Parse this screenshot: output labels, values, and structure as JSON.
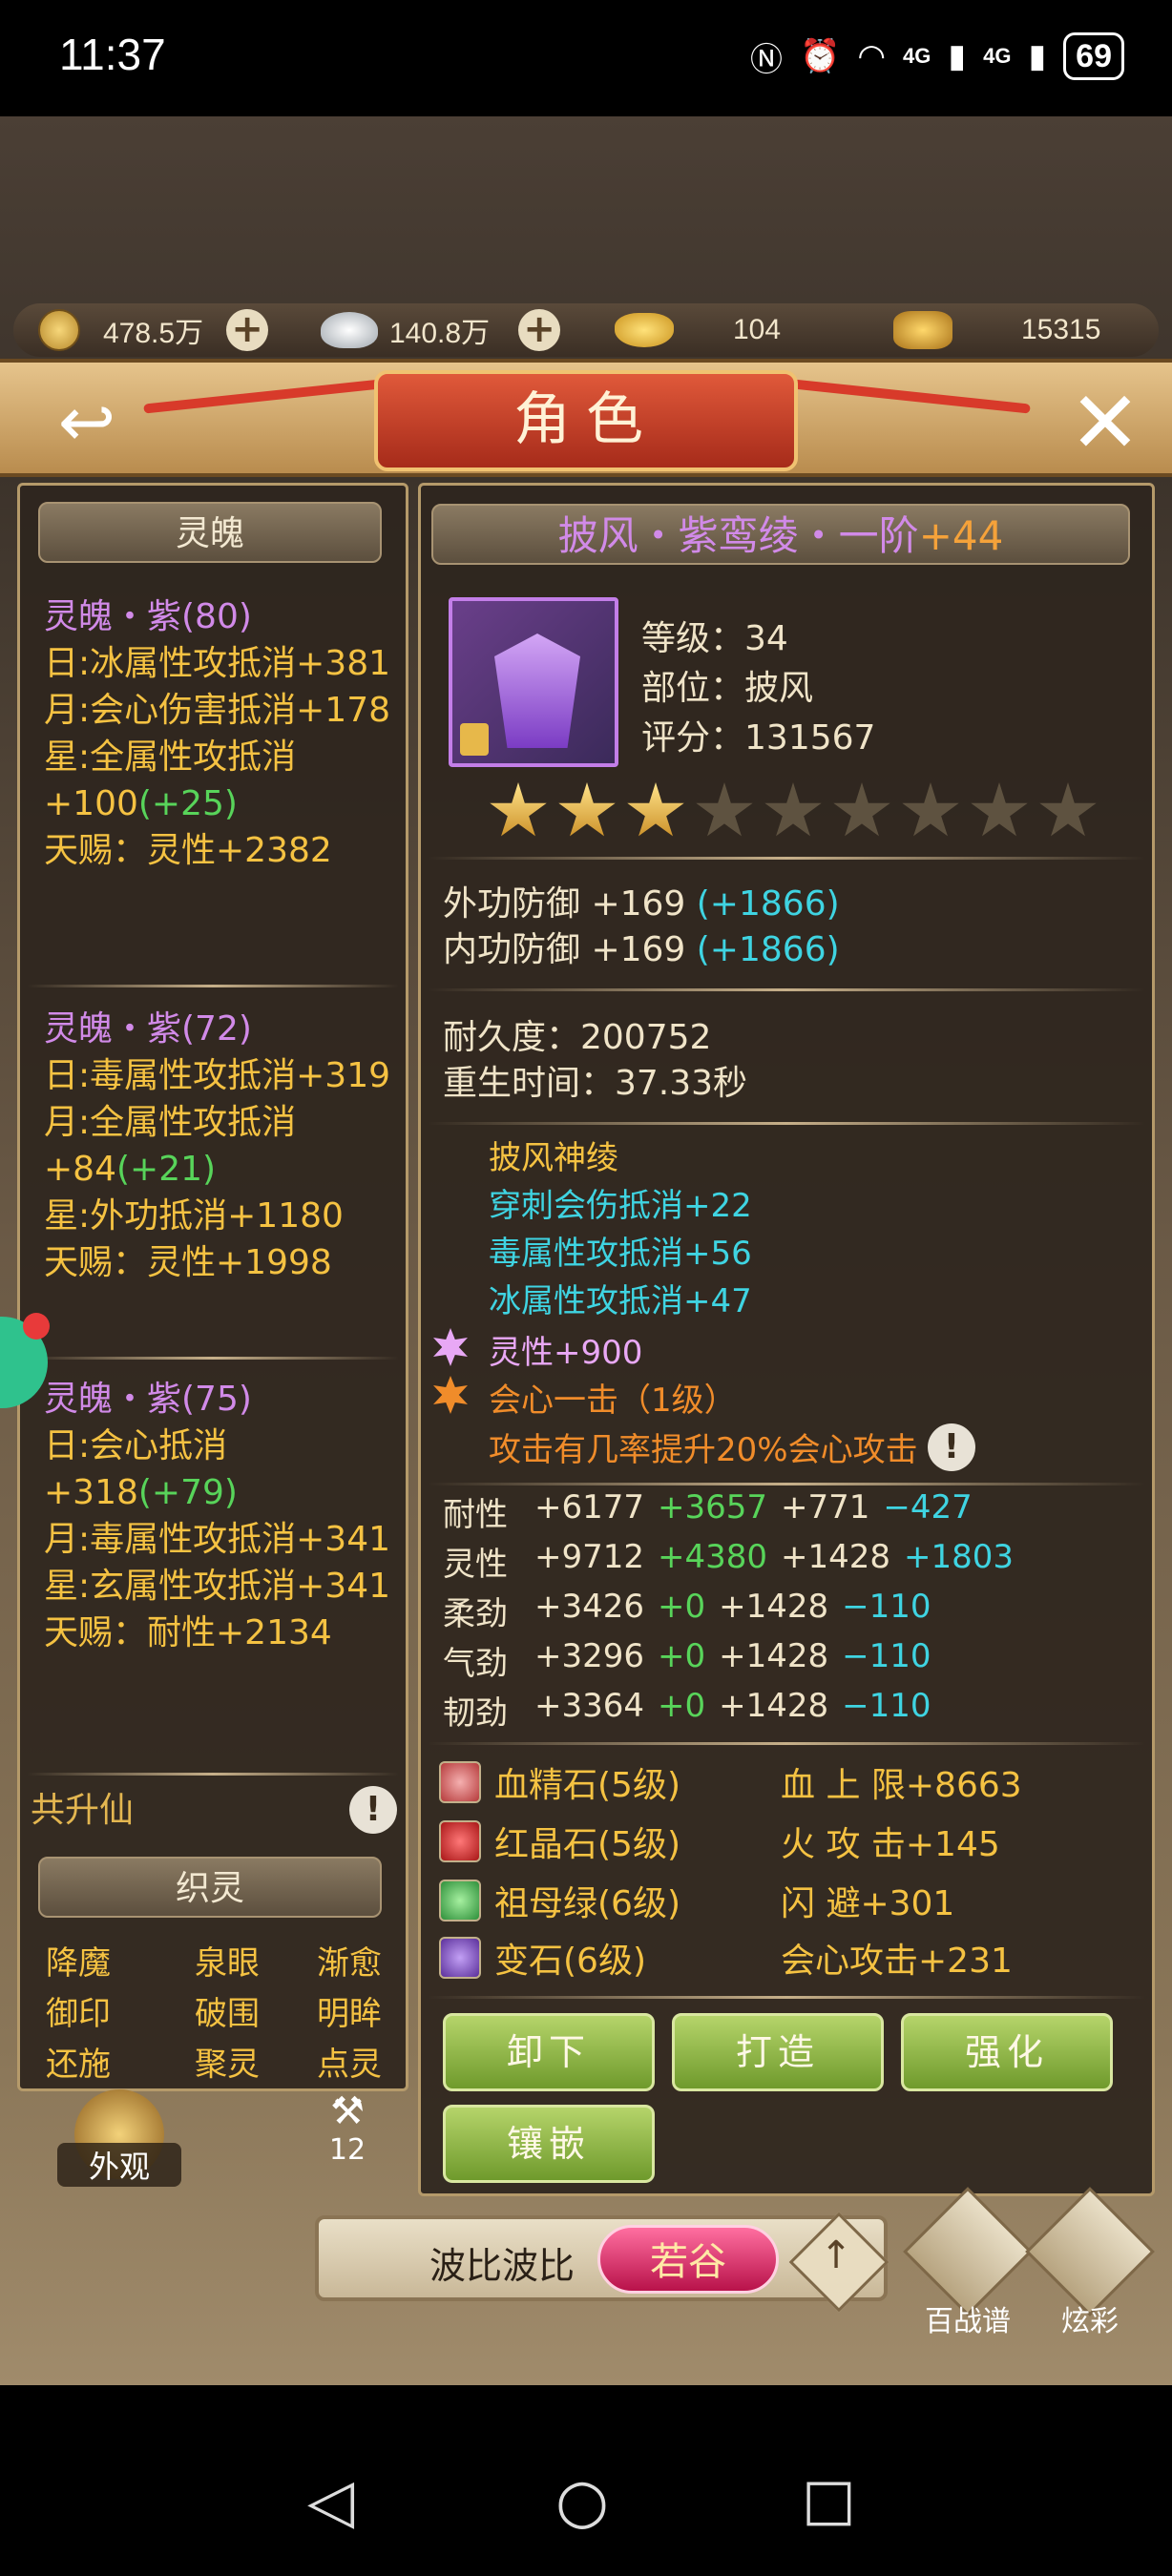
{
  "status_bar": {
    "time": "11:37",
    "battery": "69",
    "net1": "4G",
    "net2": "4G"
  },
  "currency": [
    {
      "value": "478.5万",
      "icon": "copper-coin-icon"
    },
    {
      "value": "140.8万",
      "icon": "silver-ingot-icon"
    },
    {
      "value": "104",
      "icon": "gold-ingot-icon"
    },
    {
      "value": "15315",
      "icon": "bound-gold-icon"
    }
  ],
  "header": {
    "title": "角色"
  },
  "left_panel": {
    "title": "灵魄",
    "groups": [
      {
        "name": "灵魄・紫(80)",
        "lines": [
          {
            "text": "日:冰属性攻抵消+381",
            "extra": ""
          },
          {
            "text": "月:会心伤害抵消+178",
            "extra": ""
          },
          {
            "text": "星:全属性攻抵消+100",
            "extra": "(+25)"
          },
          {
            "text": "天赐：灵性+2382",
            "extra": ""
          }
        ]
      },
      {
        "name": "灵魄・紫(72)",
        "lines": [
          {
            "text": "日:毒属性攻抵消+319",
            "extra": ""
          },
          {
            "text": "月:全属性攻抵消+84",
            "extra": "(+21)"
          },
          {
            "text": "星:外功抵消+1180",
            "extra": ""
          },
          {
            "text": "天赐：灵性+1998",
            "extra": ""
          }
        ]
      },
      {
        "name": "灵魄・紫(75)",
        "lines": [
          {
            "text": "日:会心抵消+318",
            "extra": "(+79)"
          },
          {
            "text": "月:毒属性攻抵消+341",
            "extra": ""
          },
          {
            "text": "星:玄属性攻抵消+341",
            "extra": ""
          },
          {
            "text": "天赐：耐性+2134",
            "extra": ""
          }
        ]
      }
    ],
    "gongsheng": "共升仙",
    "weave_title": "织灵",
    "weave_items": [
      "降魔",
      "泉眼",
      "渐愈",
      "御印",
      "破围",
      "明眸",
      "还施",
      "聚灵",
      "点灵"
    ]
  },
  "item": {
    "name": "披风・紫鸾绫・一阶",
    "plus": "+44",
    "level_label": "等级：",
    "level": "34",
    "slot_label": "部位：",
    "slot": "披风",
    "score_label": "评分：",
    "score": "131567",
    "stars_filled": 3,
    "stars_total": 9,
    "defense": [
      {
        "base": "外功防御 +169 ",
        "bonus": "(+1866)"
      },
      {
        "base": "内功防御 +169 ",
        "bonus": "(+1866)"
      }
    ],
    "durability": "耐久度：200752",
    "respawn": "重生时间：37.33秒",
    "set_name": "披风神绫",
    "set_effects": [
      "穿刺会伤抵消+22",
      "毒属性攻抵消+56",
      "冰属性攻抵消+47"
    ],
    "spirit": "灵性+900",
    "skill": "会心一击（1级）",
    "skill_desc": "攻击有几率提升20%会心攻击",
    "attributes": [
      {
        "name": "耐性",
        "base": "+6177",
        "green": "+3657",
        "white": "+771",
        "cyan": "−427"
      },
      {
        "name": "灵性",
        "base": "+9712",
        "green": "+4380",
        "white": "+1428",
        "cyan": "+1803"
      },
      {
        "name": "柔劲",
        "base": "+3426",
        "green": "+0",
        "white": "+1428",
        "cyan": "−110"
      },
      {
        "name": "气劲",
        "base": "+3296",
        "green": "+0",
        "white": "+1428",
        "cyan": "−110"
      },
      {
        "name": "韧劲",
        "base": "+3364",
        "green": "+0",
        "white": "+1428",
        "cyan": "−110"
      }
    ],
    "gems": [
      {
        "name": "血精石(5级)",
        "bonus": "血 上 限+8663",
        "color": "#e36a6a"
      },
      {
        "name": "红晶石(5级)",
        "bonus": "火 攻 击+145",
        "color": "#e34848"
      },
      {
        "name": "祖母绿(6级)",
        "bonus": "闪   避+301",
        "color": "#5fd36a"
      },
      {
        "name": "变石(6级)",
        "bonus": "会心攻击+231",
        "color": "#9a5fd3"
      }
    ],
    "buttons": [
      "卸下",
      "打造",
      "强化",
      "镶嵌"
    ]
  },
  "bottom": {
    "outfit_label": "外观",
    "hammer_count": "12",
    "player_name": "波比波比",
    "title_tag": "若谷",
    "codex_label": "百战谱",
    "color_label": "炫彩"
  }
}
